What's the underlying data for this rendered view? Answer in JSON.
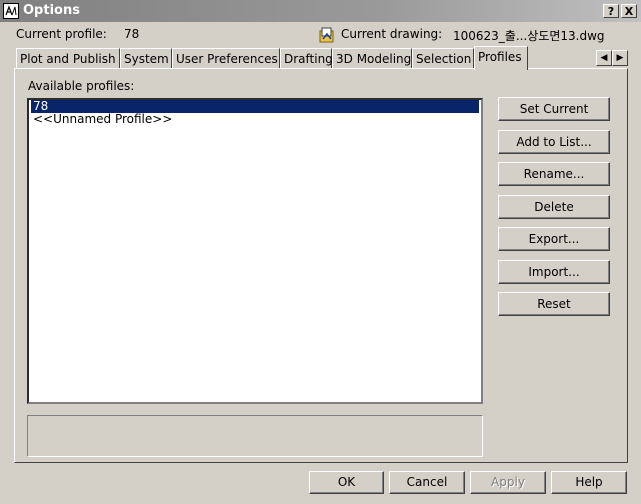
{
  "window": {
    "title": "Options",
    "help_button": "?",
    "close_button": "X"
  },
  "header": {
    "current_profile_label": "Current profile:",
    "current_profile_value": "78",
    "current_drawing_label": "Current drawing:",
    "current_drawing_value": "100623_출...상도면13.dwg"
  },
  "tabs": [
    {
      "label": "Plot and Publish"
    },
    {
      "label": "System"
    },
    {
      "label": "User Preferences"
    },
    {
      "label": "Drafting"
    },
    {
      "label": "3D Modeling"
    },
    {
      "label": "Selection"
    },
    {
      "label": "Profiles"
    }
  ],
  "active_tab": "Profiles",
  "profiles": {
    "available_label": "Available profiles:",
    "items": [
      "78",
      "<<Unnamed Profile>>"
    ],
    "selected": "78"
  },
  "side_buttons": {
    "set_current": "Set Current",
    "add_to_list": "Add to List...",
    "rename": "Rename...",
    "delete": "Delete",
    "export": "Export...",
    "import": "Import...",
    "reset": "Reset"
  },
  "bottom_buttons": {
    "ok": "OK",
    "cancel": "Cancel",
    "apply": "Apply",
    "help": "Help"
  },
  "colors": {
    "selection": "#0a246a",
    "face": "#d4d0c8"
  }
}
